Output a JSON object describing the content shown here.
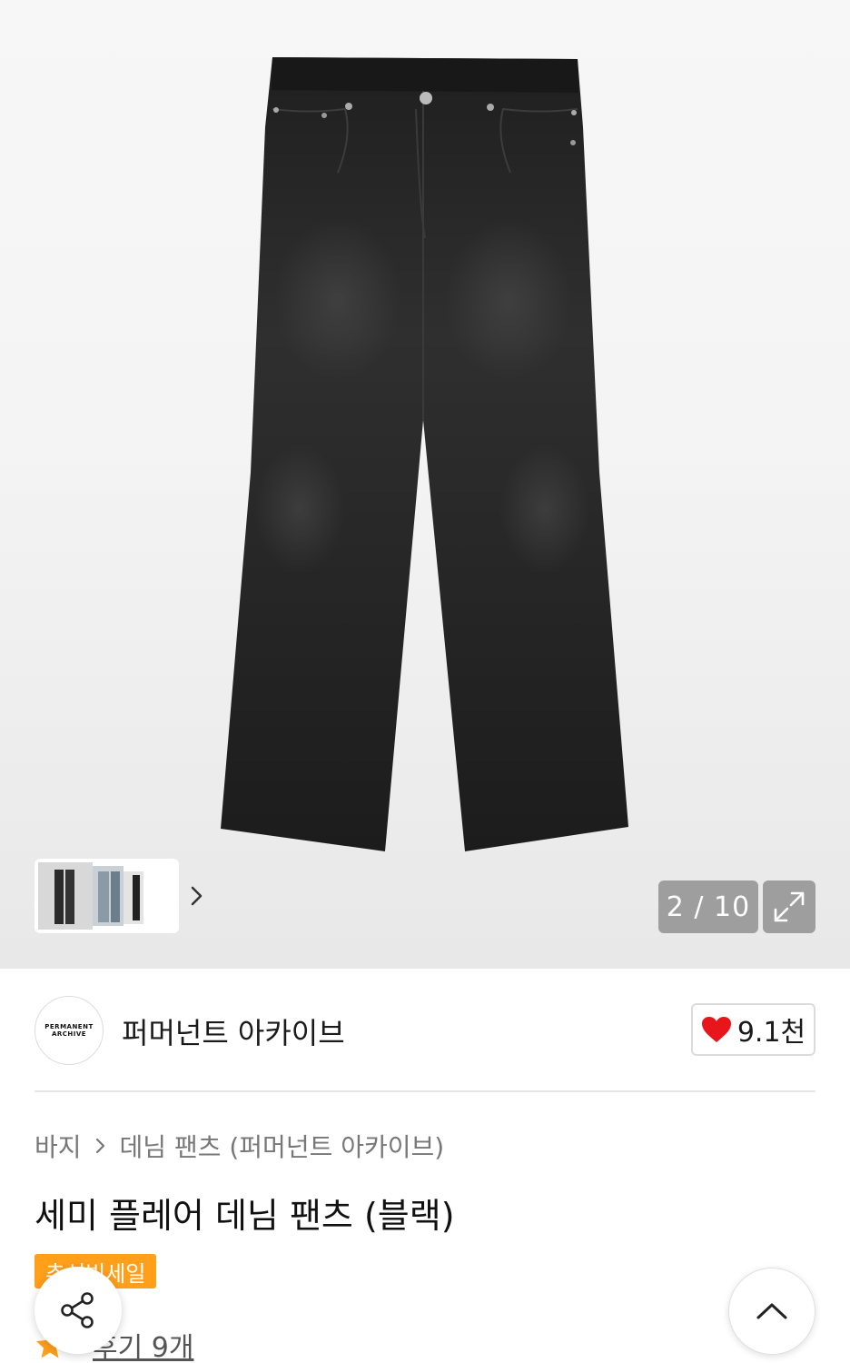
{
  "gallery": {
    "counter": "2 / 10",
    "image_alt": "product-photo-black-flare-jeans",
    "current_index": 2,
    "total_images": 10
  },
  "icons": {
    "thumbnails_next": "chevron-right-icon",
    "expand": "expand-arrows-icon",
    "like": "heart-icon",
    "breadcrumb_separator": "chevron-right-icon",
    "review": "star-icon",
    "share": "share-icon",
    "scroll_top": "chevron-up-icon"
  },
  "brand": {
    "logo_line1": "PERMANENT",
    "logo_line2": "ARCHIVE",
    "name": "퍼머넌트 아카이브",
    "like_count": "9.1천"
  },
  "breadcrumb": {
    "category": "바지",
    "subcategory": "데님 팬츠 (퍼머넌트 아카이브)"
  },
  "product": {
    "title": "세미 플레어 데님 팬츠 (블랙)",
    "badge": "추석빅세일",
    "review_link": "후기 9개"
  },
  "colors": {
    "accent": "#ff9f1a",
    "heart": "#e8161b",
    "counter_bg": "#9e9e9e"
  }
}
